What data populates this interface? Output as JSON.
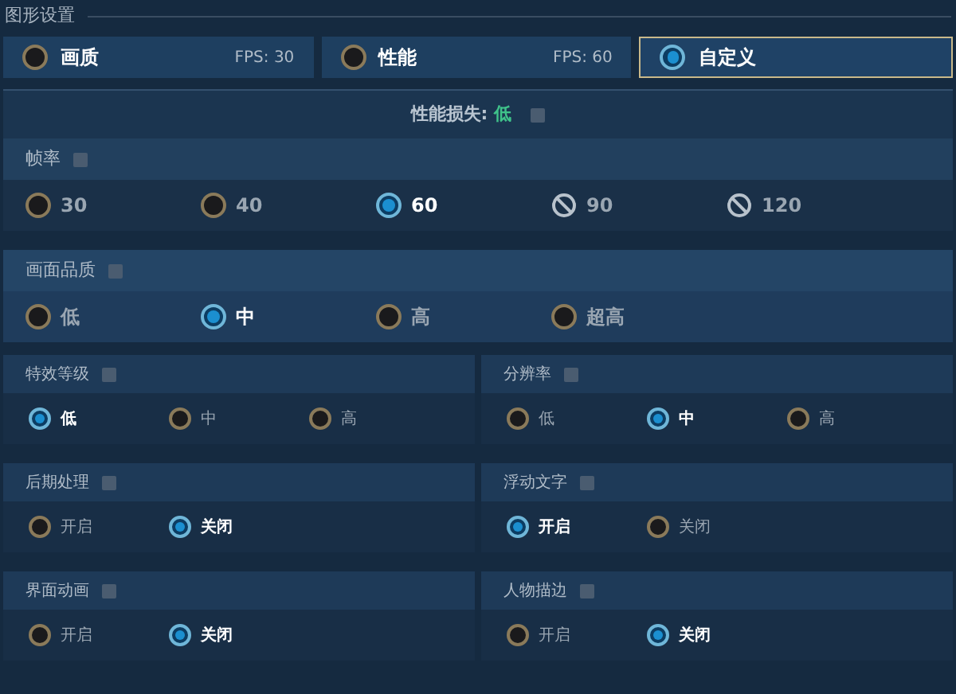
{
  "title": "图形设置",
  "presets": [
    {
      "label": "画质",
      "fps": "FPS: 30",
      "selected": false
    },
    {
      "label": "性能",
      "fps": "FPS: 60",
      "selected": false
    },
    {
      "label": "自定义",
      "selected": true
    }
  ],
  "performance_loss": {
    "label": "性能损失:",
    "value": "低"
  },
  "wide_groups": [
    {
      "title": "帧率",
      "options": [
        {
          "label": "30",
          "selected": false,
          "disabled": false
        },
        {
          "label": "40",
          "selected": false,
          "disabled": false
        },
        {
          "label": "60",
          "selected": true,
          "disabled": false
        },
        {
          "label": "90",
          "selected": false,
          "disabled": true
        },
        {
          "label": "120",
          "selected": false,
          "disabled": true
        }
      ]
    },
    {
      "title": "画面品质",
      "options": [
        {
          "label": "低",
          "selected": false,
          "disabled": false
        },
        {
          "label": "中",
          "selected": true,
          "disabled": false
        },
        {
          "label": "高",
          "selected": false,
          "disabled": false
        },
        {
          "label": "超高",
          "selected": false,
          "disabled": false
        }
      ]
    }
  ],
  "grid_groups": [
    {
      "title": "特效等级",
      "options": [
        {
          "label": "低",
          "selected": true
        },
        {
          "label": "中",
          "selected": false
        },
        {
          "label": "高",
          "selected": false
        }
      ]
    },
    {
      "title": "分辨率",
      "options": [
        {
          "label": "低",
          "selected": false
        },
        {
          "label": "中",
          "selected": true
        },
        {
          "label": "高",
          "selected": false
        }
      ]
    },
    {
      "title": "后期处理",
      "options": [
        {
          "label": "开启",
          "selected": false
        },
        {
          "label": "关闭",
          "selected": true
        }
      ]
    },
    {
      "title": "浮动文字",
      "options": [
        {
          "label": "开启",
          "selected": true
        },
        {
          "label": "关闭",
          "selected": false
        }
      ]
    },
    {
      "title": "界面动画",
      "options": [
        {
          "label": "开启",
          "selected": false
        },
        {
          "label": "关闭",
          "selected": true
        }
      ]
    },
    {
      "title": "人物描边",
      "options": [
        {
          "label": "开启",
          "selected": false
        },
        {
          "label": "关闭",
          "selected": true
        }
      ]
    }
  ]
}
